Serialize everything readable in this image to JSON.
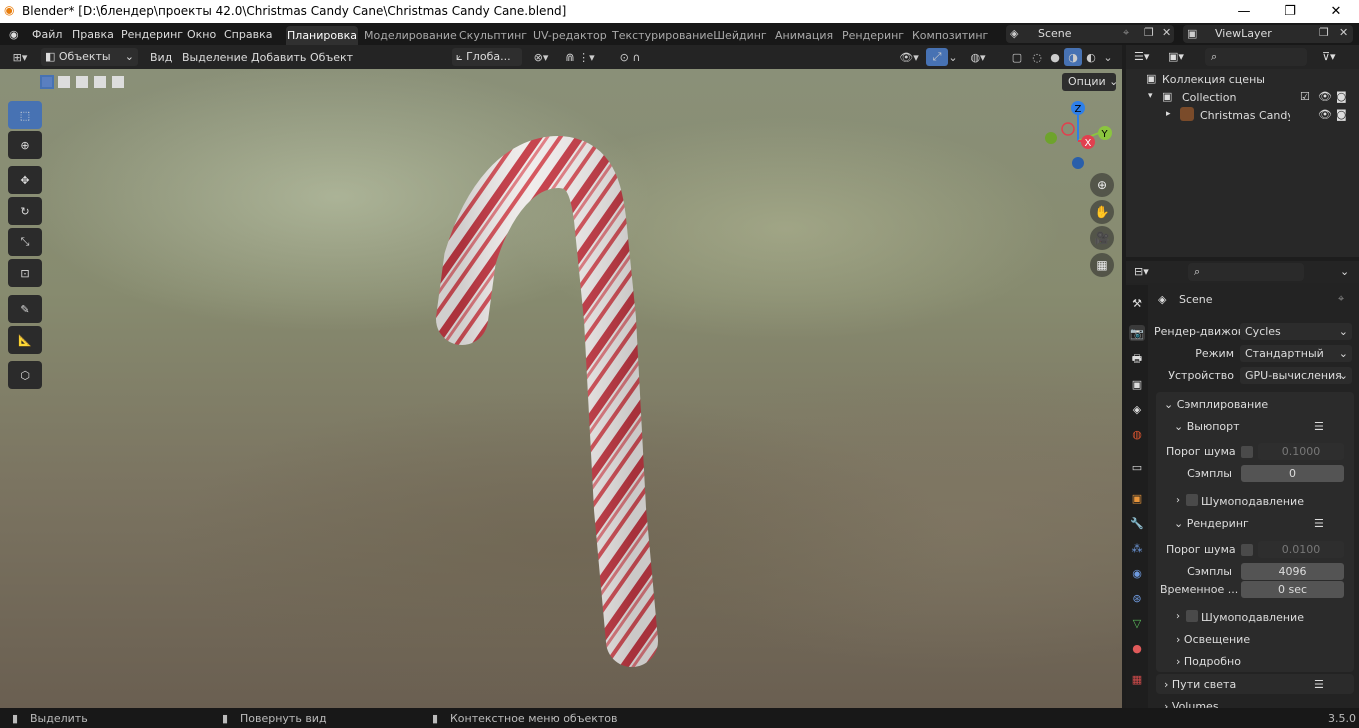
{
  "window": {
    "title": "Blender* [D:\\блендер\\проекты 42.0\\Christmas Candy Cane\\Christmas Candy Cane.blend]",
    "minimize": "—",
    "maximize": "❐",
    "close": "✕"
  },
  "menu": {
    "file": "Файл",
    "edit": "Правка",
    "render": "Рендеринг",
    "window": "Окно",
    "help": "Справка"
  },
  "workspaces": [
    "Планировка",
    "Моделирование",
    "Скульптинг",
    "UV-редактор",
    "Текстурирование",
    "Шейдинг",
    "Анимация",
    "Рендеринг",
    "Композитинг"
  ],
  "scene": {
    "name": "Scene",
    "view_layer": "ViewLayer"
  },
  "viewport_header": {
    "mode": "Объекты",
    "view": "Вид",
    "select": "Выделение",
    "add": "Добавить",
    "object": "Объект",
    "orientation": "Глоба...",
    "options": "Опции"
  },
  "gizmo": {
    "z": "Z",
    "y": "Y",
    "x": "X"
  },
  "outliner": {
    "scene_collection": "Коллекция сцены",
    "collection": "Collection",
    "object": "Christmas Candy Car"
  },
  "properties": {
    "scene_name": "Scene",
    "render_engine_label": "Рендер-движок",
    "render_engine": "Cycles",
    "mode_label": "Режим",
    "mode": "Стандартный",
    "device_label": "Устройство",
    "device": "GPU-вычисления",
    "sampling": "Сэмплирование",
    "viewport": "Выюпорт",
    "noise_threshold_label": "Порог шума",
    "viewport_noise_threshold": "0.1000",
    "samples_label": "Сэмплы",
    "viewport_samples": "0",
    "denoise": "Шумоподавление",
    "render": "Рендеринг",
    "render_noise_threshold": "0.0100",
    "render_samples": "4096",
    "time_label": "Временное ...",
    "time_limit": "0 sec",
    "lighting": "Освещение",
    "advanced": "Подробно",
    "light_paths": "Пути света",
    "volumes": "Volumes"
  },
  "status": {
    "select": "Выделить",
    "rotate": "Повернуть вид",
    "context": "Контекстное меню объектов",
    "version": "3.5.0"
  },
  "colors": {
    "accent": "#4772b3",
    "active_tab": "#303030",
    "axis_x": "#e1404f",
    "axis_y": "#8bc53f",
    "axis_z": "#2e7fe8"
  }
}
